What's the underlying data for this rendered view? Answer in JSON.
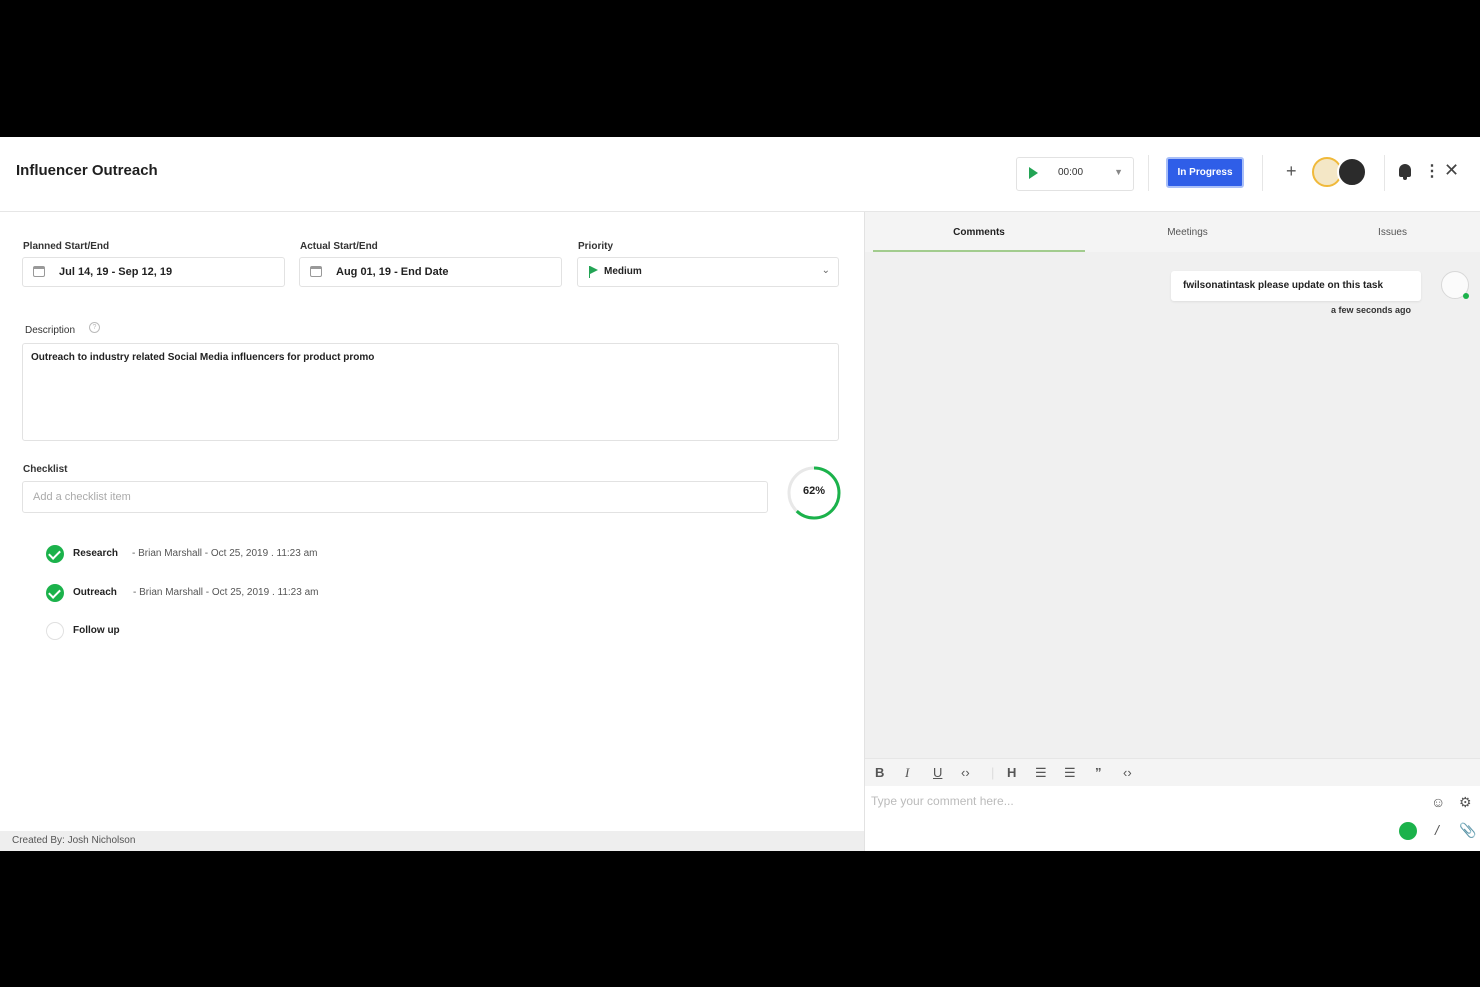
{
  "header": {
    "title": "Influencer Outreach",
    "timer": "00:00",
    "status": "In Progress"
  },
  "fields": {
    "planned_label": "Planned Start/End",
    "planned_value": "Jul 14, 19 - Sep 12, 19",
    "actual_label": "Actual Start/End",
    "actual_value": "Aug 01, 19 - End Date",
    "priority_label": "Priority",
    "priority_value": "Medium",
    "description_label": "Description",
    "description_value": "Outreach to industry related Social Media influencers for product promo"
  },
  "checklist": {
    "label": "Checklist",
    "placeholder": "Add a checklist item",
    "progress_text": "62%",
    "progress": 0.62,
    "items": [
      {
        "name": "Research",
        "meta": "- Brian Marshall - Oct 25, 2019 . 11:23 am",
        "done": true
      },
      {
        "name": "Outreach",
        "meta": "- Brian Marshall - Oct 25, 2019 . 11:23 am",
        "done": true
      },
      {
        "name": "Follow up",
        "meta": "",
        "done": false
      }
    ]
  },
  "footer": {
    "created_by": "Created By: Josh Nicholson"
  },
  "comments_panel": {
    "tabs": [
      "Comments",
      "Meetings",
      "Issues"
    ],
    "comment_text": "fwilsonatintask please update on this task",
    "comment_time": "a few seconds ago",
    "composer_placeholder": "Type your comment here..."
  },
  "colors": {
    "accent_green": "#1bb24b",
    "status_blue": "#2f5ee8"
  }
}
